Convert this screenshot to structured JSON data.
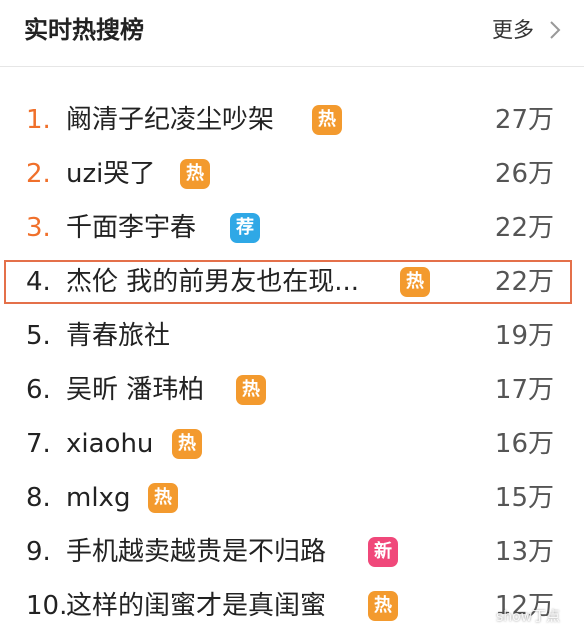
{
  "header": {
    "title": "实时热搜榜",
    "more_label": "更多"
  },
  "items": [
    {
      "rank": "1.",
      "name": "阚清子纪凌尘吵架",
      "badge": "热",
      "count": "27万"
    },
    {
      "rank": "2.",
      "name": "uzi哭了",
      "badge": "热",
      "count": "26万"
    },
    {
      "rank": "3.",
      "name": "千面李宇春",
      "badge": "荐",
      "count": "22万"
    },
    {
      "rank": "4.",
      "name": "杰伦 我的前男友也在现...",
      "badge": "热",
      "count": "22万"
    },
    {
      "rank": "5.",
      "name": "青春旅社",
      "badge": "",
      "count": "19万"
    },
    {
      "rank": "6.",
      "name": "吴昕 潘玮柏",
      "badge": "热",
      "count": "17万"
    },
    {
      "rank": "7.",
      "name": "xiaohu",
      "badge": "热",
      "count": "16万"
    },
    {
      "rank": "8.",
      "name": "mlxg",
      "badge": "热",
      "count": "15万"
    },
    {
      "rank": "9.",
      "name": "手机越卖越贵是不归路",
      "badge": "新",
      "count": "13万"
    },
    {
      "rank": "10.",
      "name": "这样的闺蜜才是真闺蜜",
      "badge": "热",
      "count": "12万"
    }
  ],
  "colors": {
    "top_rank": "#f0702b",
    "badge_hot": "#f39a2e",
    "badge_recommend": "#2fa8e6",
    "badge_new": "#f0487a",
    "highlight_border": "#e4704a"
  },
  "icons": {
    "more": "chevron-right-icon",
    "watermark": "wechat-icon"
  },
  "watermark": {
    "text": "show丁点"
  }
}
